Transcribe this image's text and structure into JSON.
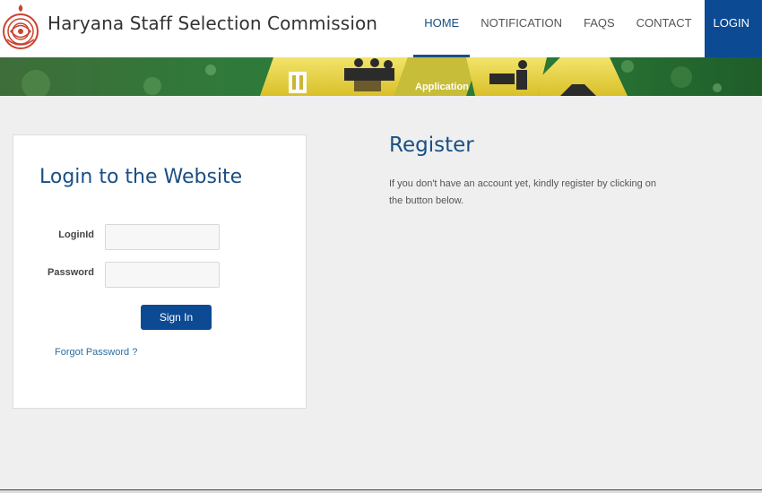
{
  "header": {
    "site_title": "Haryana Staff Selection Commission",
    "emblem_icon": "haryana-emblem-icon"
  },
  "nav": {
    "items": [
      {
        "label": "HOME",
        "active": true
      },
      {
        "label": "NOTIFICATION",
        "active": false
      },
      {
        "label": "FAQS",
        "active": false
      },
      {
        "label": "CONTACT",
        "active": false
      },
      {
        "label": "LOGIN",
        "active": false
      }
    ]
  },
  "banner": {
    "caption": "Application"
  },
  "login": {
    "heading": "Login to the Website",
    "login_id_label": "LoginId",
    "login_id_value": "",
    "password_label": "Password",
    "password_value": "",
    "sign_in_label": "Sign In",
    "forgot_label": "Forgot Password ?"
  },
  "register": {
    "heading": "Register",
    "text": "If you don't have an account yet, kindly register by clicking on the button below."
  },
  "colors": {
    "primary_blue": "#0c4a93",
    "heading_blue": "#1a4f84",
    "banner_green": "#2f7a3a",
    "banner_yellow": "#e4cf3c",
    "page_background": "#efefef"
  }
}
